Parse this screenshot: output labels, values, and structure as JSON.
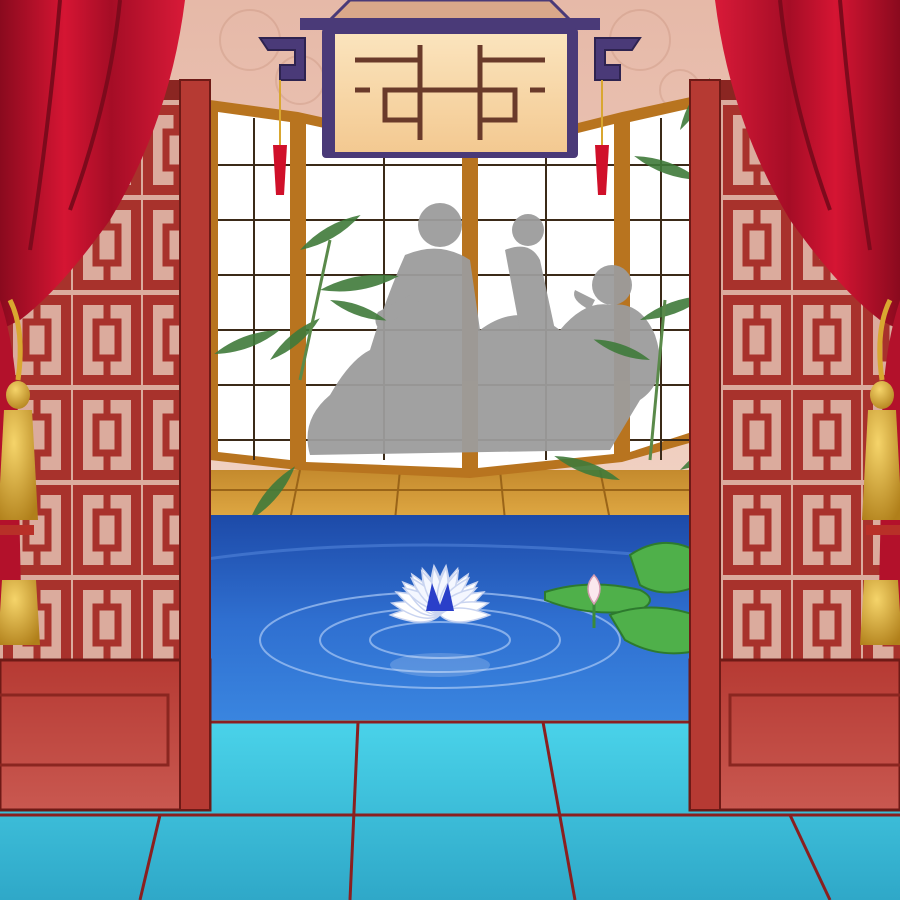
{
  "scene": {
    "type": "visual-novel-background",
    "setting": "chinese-palace-bath-pavilion"
  },
  "colors": {
    "curtain": "#c8102e",
    "curtain_shadow": "#7d0a1c",
    "lattice": "#a8322c",
    "lattice_dark": "#6e1a16",
    "wall": "#e9c3b3",
    "screen_paper": "#ffffff",
    "screen_frame": "#b8741f",
    "silhouette": "#9c9c9c",
    "pool_water": "#2f66c9",
    "floor_tile": "#3fc9e0",
    "grout": "#8a1f1f",
    "lantern_frame": "#4a3a78",
    "lantern_glow": "#f6d7a8",
    "tassel_gold": "#d9a730",
    "lily_white": "#ffffff",
    "lily_center": "#2a3fc9",
    "lily_pad": "#4fb04a"
  },
  "icons": [
    "hanging-lantern-icon",
    "lotus-flower-icon",
    "lotus-bud-icon",
    "lily-pad-icon",
    "gold-tassel-icon",
    "bamboo-icon"
  ]
}
